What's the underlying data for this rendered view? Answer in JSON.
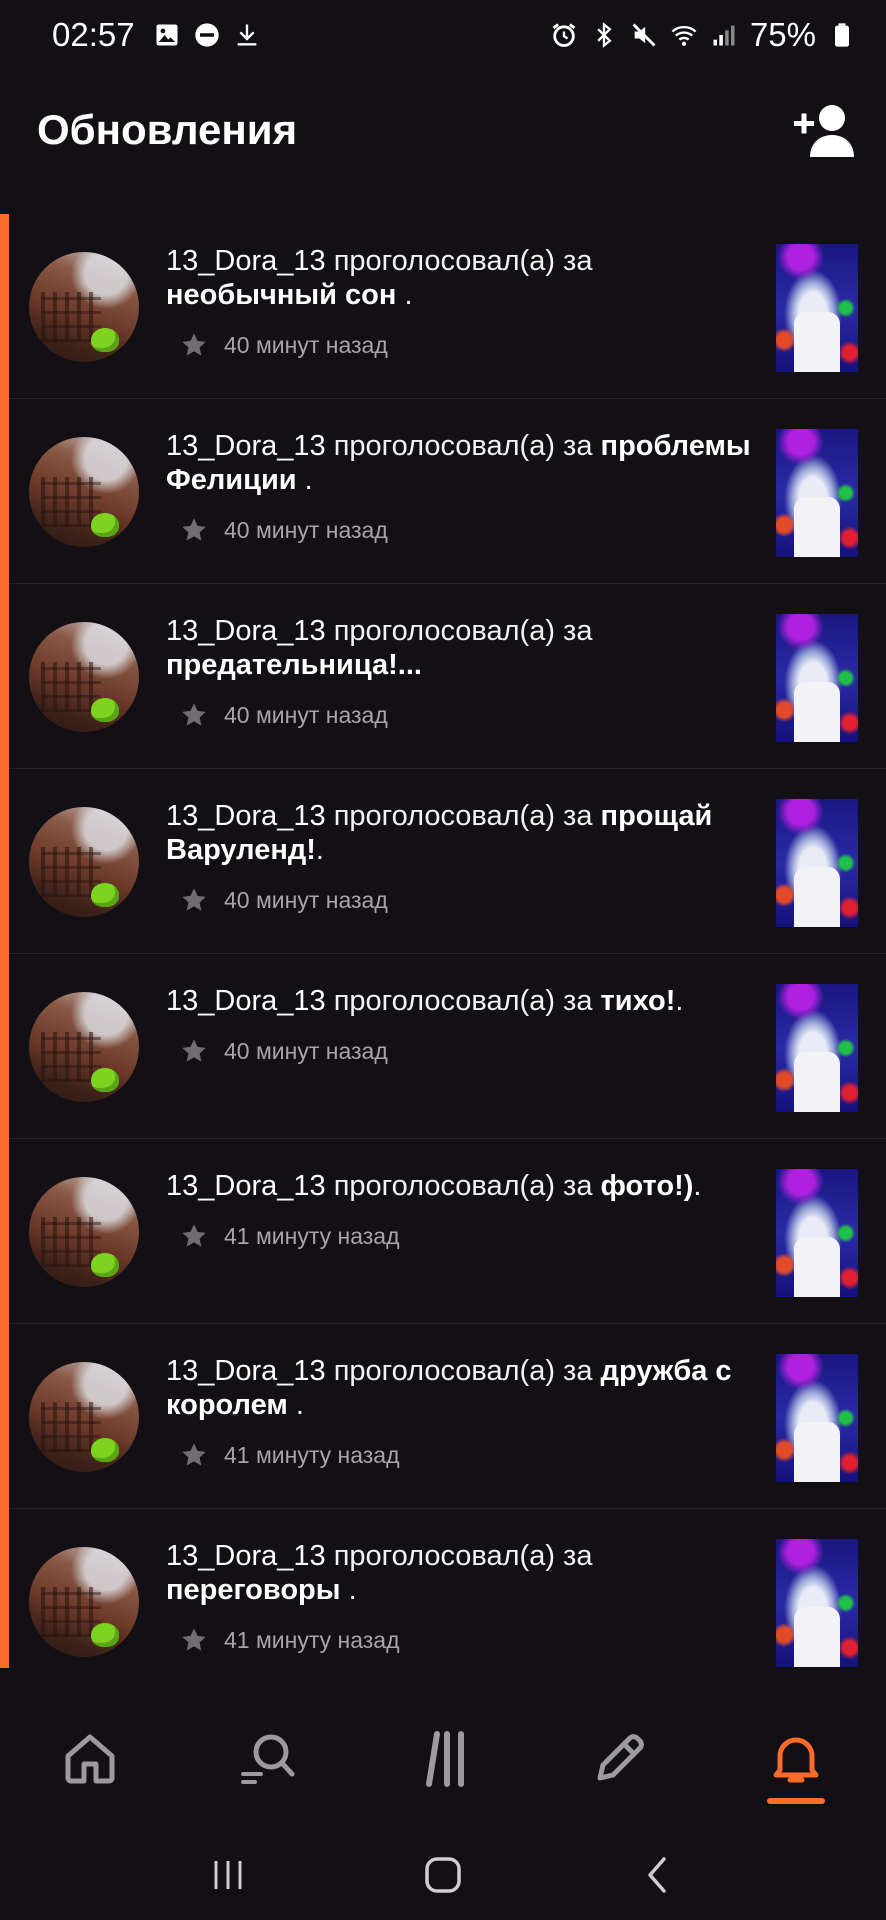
{
  "status_bar": {
    "time": "02:57",
    "battery": "75%",
    "left_icons": [
      "image-icon",
      "do-not-disturb-icon",
      "download-icon"
    ],
    "right_icons": [
      "alarm-icon",
      "bluetooth-icon",
      "mute-icon",
      "wifi-icon",
      "signal-icon",
      "battery-icon"
    ]
  },
  "header": {
    "title": "Обновления",
    "action_icon": "add-user-icon"
  },
  "accent_color": "#fa6a2b",
  "feed": [
    {
      "user": "13_Dora_13",
      "action": " проголосовал(а) за ",
      "title": "необычный сон",
      "suffix": " .",
      "time": "40 минут назад"
    },
    {
      "user": "13_Dora_13",
      "action": " проголосовал(а) за ",
      "title": "проблемы Фелиции",
      "suffix": " .",
      "time": "40 минут назад"
    },
    {
      "user": "13_Dora_13",
      "action": " проголосовал(а) за ",
      "title": "предательница!...",
      "suffix": "",
      "time": "40 минут назад"
    },
    {
      "user": "13_Dora_13",
      "action": " проголосовал(а) за ",
      "title": "прощай Варуленд!",
      "suffix": ".",
      "time": "40 минут назад"
    },
    {
      "user": "13_Dora_13",
      "action": " проголосовал(а) за ",
      "title": "тихо!",
      "suffix": ".",
      "time": "40 минут назад"
    },
    {
      "user": "13_Dora_13",
      "action": " проголосовал(а) за ",
      "title": "фото!)",
      "suffix": ".",
      "time": "41 минуту назад"
    },
    {
      "user": "13_Dora_13",
      "action": " проголосовал(а) за ",
      "title": "дружба с королем",
      "suffix": " .",
      "time": "41 минуту назад"
    },
    {
      "user": "13_Dora_13",
      "action": " проголосовал(а) за ",
      "title": "переговоры",
      "suffix": " .",
      "time": "41 минуту назад"
    }
  ],
  "bottom_nav": {
    "items": [
      "home-icon",
      "search-icon",
      "library-icon",
      "write-icon",
      "notifications-icon"
    ],
    "active": "notifications-icon"
  },
  "system_nav": [
    "recent-apps-icon",
    "home-button-icon",
    "back-icon"
  ]
}
